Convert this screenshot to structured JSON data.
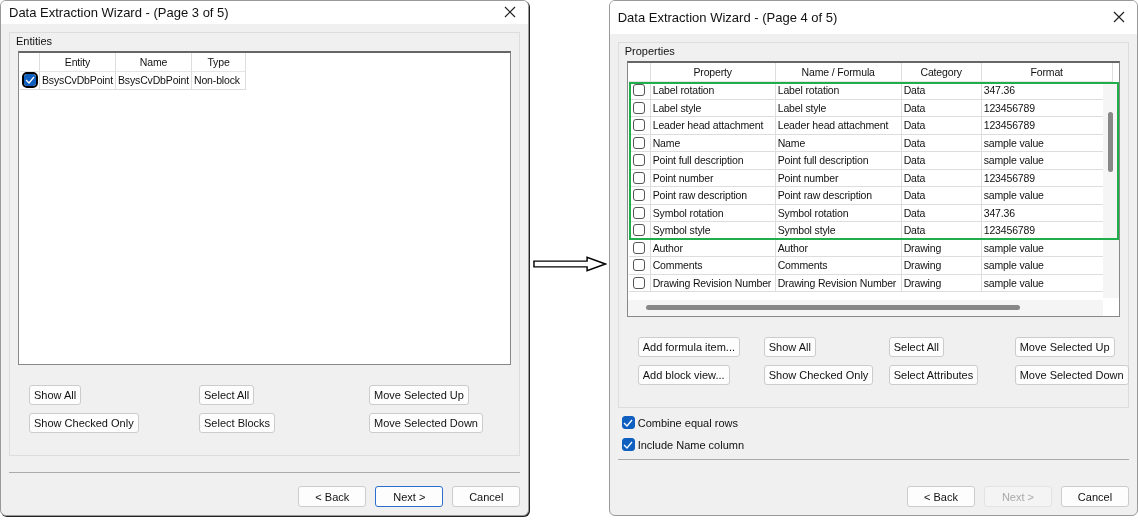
{
  "dialogs": [
    {
      "title": "Data Extraction Wizard - (Page 3 of 5)",
      "group": "Entities",
      "table": {
        "kind": "entities",
        "scrollable": false,
        "columns": [
          "Entity",
          "Name",
          "Type"
        ],
        "rows": [
          {
            "checked": true,
            "focused": true,
            "highlighted": false,
            "cells": [
              "BsysCvDbPoint",
              "BsysCvDbPoint",
              "Non-block"
            ]
          }
        ]
      },
      "buttons": [
        "Show All",
        "Select All",
        "Move Selected Up",
        "Show Checked Only",
        "Select Blocks",
        "Move Selected Down"
      ],
      "nav": [
        {
          "label": "< Back",
          "default": false,
          "disabled": false
        },
        {
          "label": "Next >",
          "default": true,
          "disabled": false
        },
        {
          "label": "Cancel",
          "default": false,
          "disabled": false
        }
      ]
    },
    {
      "title": "Data Extraction Wizard - (Page 4 of 5)",
      "group": "Properties",
      "table": {
        "kind": "properties",
        "scrollable": true,
        "columns": [
          "Property",
          "Name / Formula",
          "Category",
          "Format"
        ],
        "rows": [
          {
            "checked": false,
            "focused": false,
            "highlighted": true,
            "cells": [
              "Label rotation",
              "Label rotation",
              "Data",
              "347.36"
            ]
          },
          {
            "checked": false,
            "focused": false,
            "highlighted": true,
            "cells": [
              "Label style",
              "Label style",
              "Data",
              "123456789"
            ]
          },
          {
            "checked": false,
            "focused": false,
            "highlighted": true,
            "cells": [
              "Leader head attachment",
              "Leader head attachment",
              "Data",
              "123456789"
            ]
          },
          {
            "checked": false,
            "focused": false,
            "highlighted": true,
            "cells": [
              "Name",
              "Name",
              "Data",
              "sample value"
            ]
          },
          {
            "checked": false,
            "focused": false,
            "highlighted": true,
            "cells": [
              "Point full description",
              "Point full description",
              "Data",
              "sample value"
            ]
          },
          {
            "checked": false,
            "focused": false,
            "highlighted": true,
            "cells": [
              "Point number",
              "Point number",
              "Data",
              "123456789"
            ]
          },
          {
            "checked": false,
            "focused": false,
            "highlighted": true,
            "cells": [
              "Point raw description",
              "Point raw description",
              "Data",
              "sample value"
            ]
          },
          {
            "checked": false,
            "focused": false,
            "highlighted": true,
            "cells": [
              "Symbol rotation",
              "Symbol rotation",
              "Data",
              "347.36"
            ]
          },
          {
            "checked": false,
            "focused": false,
            "highlighted": true,
            "cells": [
              "Symbol style",
              "Symbol style",
              "Data",
              "123456789"
            ]
          },
          {
            "checked": false,
            "focused": false,
            "highlighted": false,
            "cells": [
              "Author",
              "Author",
              "Drawing",
              "sample value"
            ]
          },
          {
            "checked": false,
            "focused": false,
            "highlighted": false,
            "cells": [
              "Comments",
              "Comments",
              "Drawing",
              "sample value"
            ]
          },
          {
            "checked": false,
            "focused": false,
            "highlighted": false,
            "cells": [
              "Drawing Revision Number",
              "Drawing Revision Number",
              "Drawing",
              "sample value"
            ]
          }
        ]
      },
      "buttons": [
        "Add formula item...",
        "Show All",
        "Select All",
        "Move Selected Up",
        "Add block view...",
        "Show Checked Only",
        "Select Attributes",
        "Move Selected Down"
      ],
      "options": [
        {
          "label": "Combine equal rows",
          "checked": true
        },
        {
          "label": "Include Name column",
          "checked": true
        }
      ],
      "nav": [
        {
          "label": "< Back",
          "default": false,
          "disabled": false
        },
        {
          "label": "Next >",
          "default": false,
          "disabled": true
        },
        {
          "label": "Cancel",
          "default": false,
          "disabled": false
        }
      ]
    }
  ]
}
